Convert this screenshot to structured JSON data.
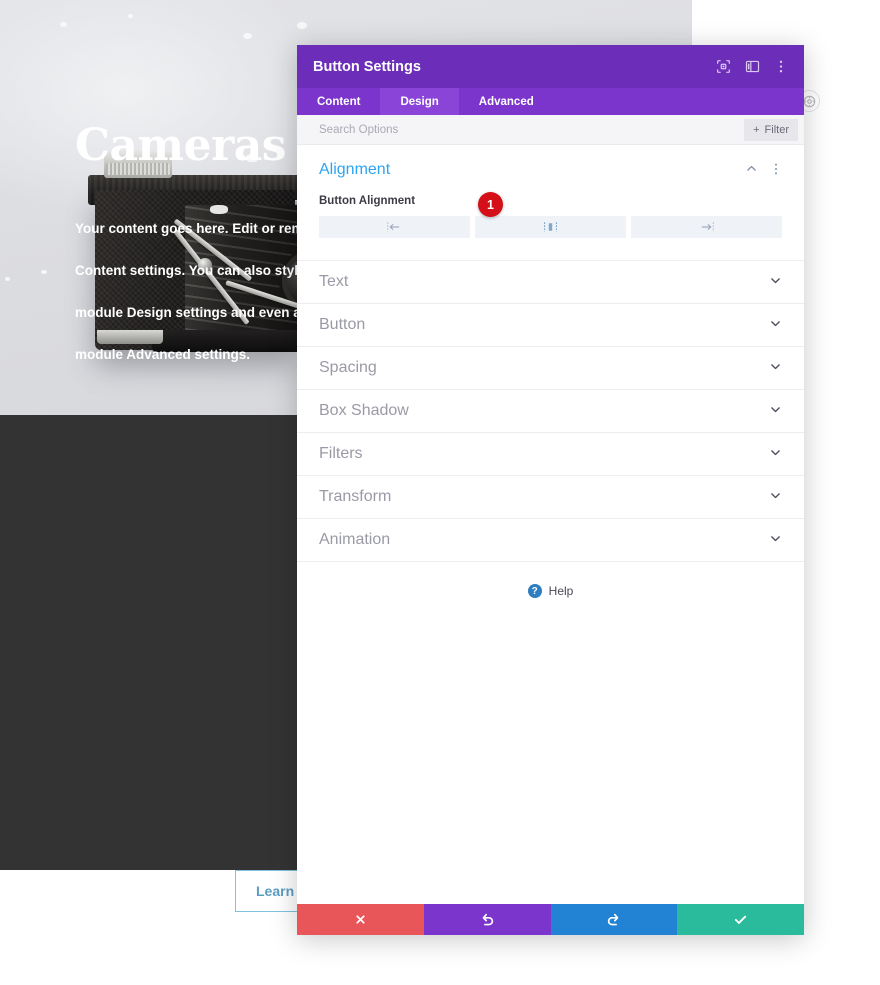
{
  "site": {
    "title": "Cameras",
    "body": "Your content goes here. Edit or remove this text inline or in the module Content settings. You can also style every aspect of this content in the module Design settings and even apply custom CSS to this text in the module Advanced settings.",
    "body_lines": [
      "Your content goes here. Edit or remove",
      "Content settings. You can also style ev",
      "module Design settings and even app",
      "module Advanced settings."
    ],
    "button_label": "Learn more",
    "orbit_icon": "settings-circle-icon"
  },
  "modal": {
    "title": "Button Settings",
    "header_icons": [
      {
        "name": "focus-target-icon"
      },
      {
        "name": "layout-panel-icon"
      },
      {
        "name": "kebab-menu-icon"
      }
    ],
    "tabs": [
      {
        "label": "Content",
        "active": false
      },
      {
        "label": "Design",
        "active": true
      },
      {
        "label": "Advanced",
        "active": false
      }
    ],
    "search": {
      "placeholder": "Search Options",
      "value": "",
      "filter_label": "Filter",
      "filter_icon": "plus-icon"
    },
    "open_section": {
      "title": "Alignment",
      "collapse_icon": "chevron-up-icon",
      "menu_icon": "kebab-menu-icon",
      "field_label": "Button Alignment",
      "options": [
        {
          "value": "left",
          "icon": "align-left-icon",
          "selected": false
        },
        {
          "value": "center",
          "icon": "align-center-icon",
          "selected": true
        },
        {
          "value": "right",
          "icon": "align-right-icon",
          "selected": false
        }
      ]
    },
    "sections": [
      {
        "label": "Text"
      },
      {
        "label": "Button"
      },
      {
        "label": "Spacing"
      },
      {
        "label": "Box Shadow"
      },
      {
        "label": "Filters"
      },
      {
        "label": "Transform"
      },
      {
        "label": "Animation"
      }
    ],
    "help": {
      "label": "Help",
      "badge": "?"
    },
    "footer": [
      {
        "name": "cancel-button",
        "icon": "close-x-icon",
        "color": "#e8565a"
      },
      {
        "name": "undo-button",
        "icon": "undo-icon",
        "color": "#7b35cc"
      },
      {
        "name": "redo-button",
        "icon": "redo-icon",
        "color": "#2282d4"
      },
      {
        "name": "save-button",
        "icon": "check-icon",
        "color": "#29bb9c"
      }
    ]
  },
  "annotation": {
    "step_number": "1"
  },
  "colors": {
    "header_purple": "#6c2eb9",
    "tab_purple": "#7b35cc",
    "tab_active_purple": "#8a45d8",
    "accent_blue": "#2ea3f2",
    "badge_red": "#d40f18"
  }
}
